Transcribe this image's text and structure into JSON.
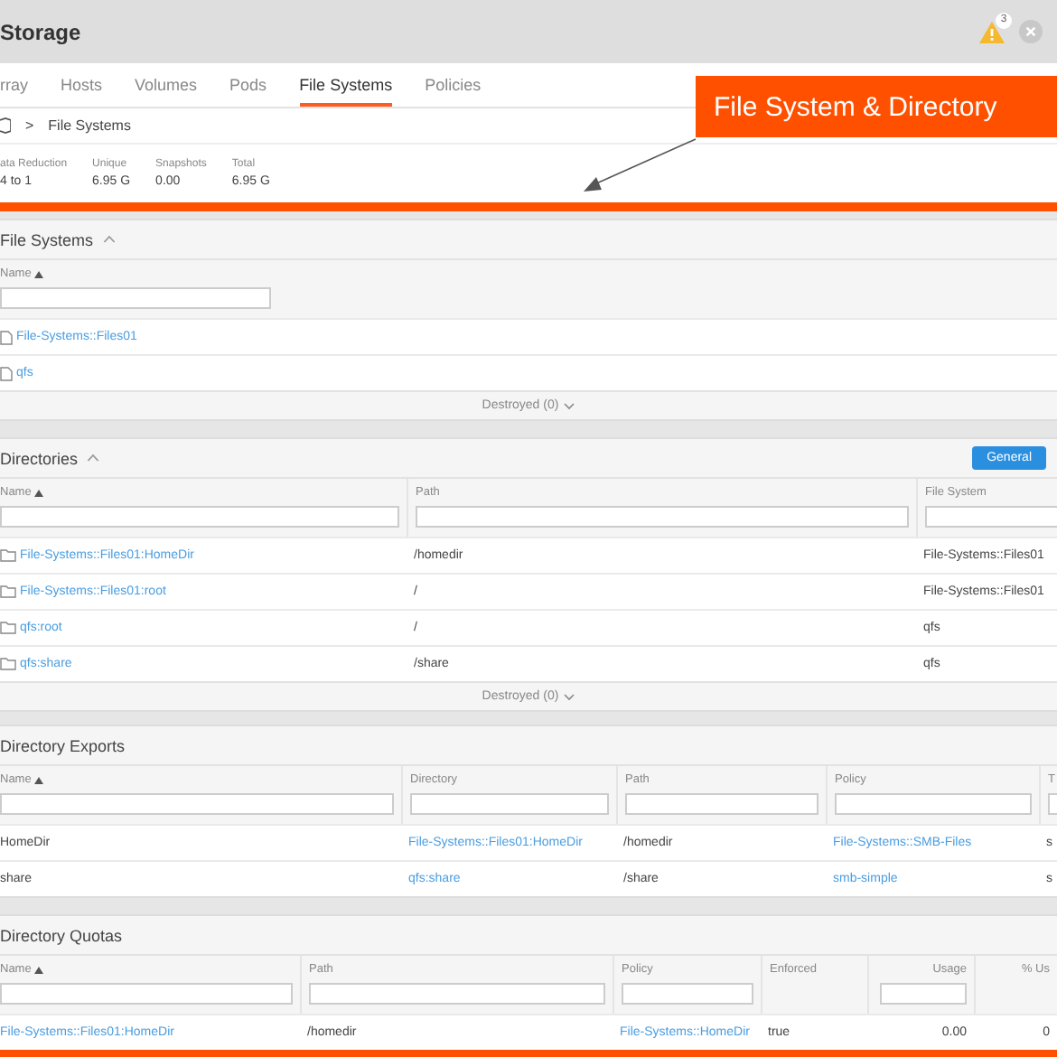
{
  "window": {
    "title": "Storage",
    "alert_count": "3"
  },
  "tabs": [
    {
      "label": "rray",
      "selected": false
    },
    {
      "label": "Hosts",
      "selected": false
    },
    {
      "label": "Volumes",
      "selected": false
    },
    {
      "label": "Pods",
      "selected": false
    },
    {
      "label": "File Systems",
      "selected": true
    },
    {
      "label": "Policies",
      "selected": false
    }
  ],
  "breadcrumb": {
    "separator": ">",
    "current": "File Systems"
  },
  "stats": [
    {
      "label": "ata Reduction",
      "value": "4 to 1"
    },
    {
      "label": "Unique",
      "value": "6.95 G"
    },
    {
      "label": "Snapshots",
      "value": "0.00"
    },
    {
      "label": "Total",
      "value": "6.95 G"
    }
  ],
  "annotation": {
    "text": "File System & Directory"
  },
  "sections": [
    {
      "title": "File Systems",
      "collapsible": true,
      "columns": [
        {
          "label": "Name",
          "sorted": true,
          "filter": true,
          "kind": "text"
        }
      ],
      "rows": [
        [
          {
            "text": "File-Systems::Files01",
            "kind": "file"
          }
        ],
        [
          {
            "text": "qfs",
            "kind": "file"
          }
        ]
      ],
      "footer": "Destroyed (0)"
    },
    {
      "title": "Directories",
      "collapsible": true,
      "action": "General",
      "columns": [
        {
          "label": "Name",
          "sorted": true,
          "filter": true,
          "kind": "text"
        },
        {
          "label": "Path",
          "sorted": false,
          "filter": true,
          "kind": "text"
        },
        {
          "label": "File System",
          "sorted": false,
          "filter": true,
          "kind": "text"
        }
      ],
      "rows": [
        [
          {
            "text": "File-Systems::Files01:HomeDir",
            "kind": "folder"
          },
          {
            "text": "/homedir",
            "kind": "text"
          },
          {
            "text": "File-Systems::Files01",
            "kind": "text"
          }
        ],
        [
          {
            "text": "File-Systems::Files01:root",
            "kind": "folder"
          },
          {
            "text": "/",
            "kind": "text"
          },
          {
            "text": "File-Systems::Files01",
            "kind": "text"
          }
        ],
        [
          {
            "text": "qfs:root",
            "kind": "folder"
          },
          {
            "text": "/",
            "kind": "text"
          },
          {
            "text": "qfs",
            "kind": "text"
          }
        ],
        [
          {
            "text": "qfs:share",
            "kind": "folder"
          },
          {
            "text": "/share",
            "kind": "text"
          },
          {
            "text": "qfs",
            "kind": "text"
          }
        ]
      ],
      "footer": "Destroyed (0)"
    },
    {
      "title": "Directory Exports",
      "collapsible": false,
      "columns": [
        {
          "label": "Name",
          "sorted": true,
          "filter": true,
          "kind": "text"
        },
        {
          "label": "Directory",
          "sorted": false,
          "filter": true,
          "kind": "text"
        },
        {
          "label": "Path",
          "sorted": false,
          "filter": true,
          "kind": "text"
        },
        {
          "label": "Policy",
          "sorted": false,
          "filter": true,
          "kind": "text"
        },
        {
          "label": "T",
          "sorted": false,
          "filter": true,
          "kind": "text"
        }
      ],
      "rows": [
        [
          {
            "text": "HomeDir",
            "kind": "text"
          },
          {
            "text": "File-Systems::Files01:HomeDir",
            "kind": "link"
          },
          {
            "text": "/homedir",
            "kind": "text"
          },
          {
            "text": "File-Systems::SMB-Files",
            "kind": "link"
          },
          {
            "text": "s",
            "kind": "text"
          }
        ],
        [
          {
            "text": "share",
            "kind": "text"
          },
          {
            "text": "qfs:share",
            "kind": "link"
          },
          {
            "text": "/share",
            "kind": "text"
          },
          {
            "text": "smb-simple",
            "kind": "link"
          },
          {
            "text": "s",
            "kind": "text"
          }
        ]
      ]
    },
    {
      "title": "Directory Quotas",
      "collapsible": false,
      "columns": [
        {
          "label": "Name",
          "sorted": true,
          "filter": true,
          "kind": "text"
        },
        {
          "label": "Path",
          "sorted": false,
          "filter": true,
          "kind": "text"
        },
        {
          "label": "Policy",
          "sorted": false,
          "filter": true,
          "kind": "text"
        },
        {
          "label": "Enforced",
          "sorted": false,
          "filter": false,
          "kind": "text"
        },
        {
          "label": "Usage",
          "sorted": false,
          "filter": true,
          "kind": "number"
        },
        {
          "label": "% Us",
          "sorted": false,
          "filter": false,
          "kind": "number"
        }
      ],
      "rows": [
        [
          {
            "text": "File-Systems::Files01:HomeDir",
            "kind": "link"
          },
          {
            "text": "/homedir",
            "kind": "text"
          },
          {
            "text": "File-Systems::HomeDir",
            "kind": "link"
          },
          {
            "text": "true",
            "kind": "text"
          },
          {
            "text": "0.00",
            "kind": "text"
          },
          {
            "text": "0",
            "kind": "text"
          }
        ]
      ]
    }
  ]
}
